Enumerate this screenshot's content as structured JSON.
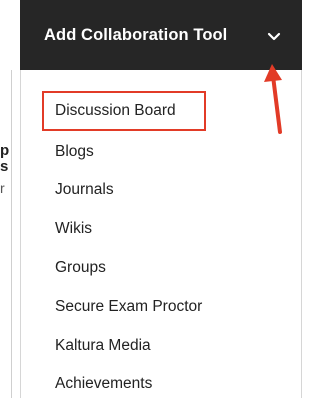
{
  "toolbar": {
    "label": "Add Collaboration Tool",
    "icon": "chevron-down-icon"
  },
  "menu": {
    "items": [
      "Discussion Board",
      "Blogs",
      "Journals",
      "Wikis",
      "Groups",
      "Secure Exam Proctor",
      "Kaltura Media",
      "Achievements"
    ],
    "highlighted_item": "Discussion Board"
  },
  "background_page": {
    "fragment_1": "p",
    "fragment_2": "s",
    "fragment_3": "r"
  },
  "colors": {
    "toolbar_background": "#262626",
    "toolbar_text": "#ffffff",
    "annotation_red": "#e23b27"
  },
  "annotations": {
    "highlight_box": "around Discussion Board",
    "arrow": "pointing to chevron"
  }
}
